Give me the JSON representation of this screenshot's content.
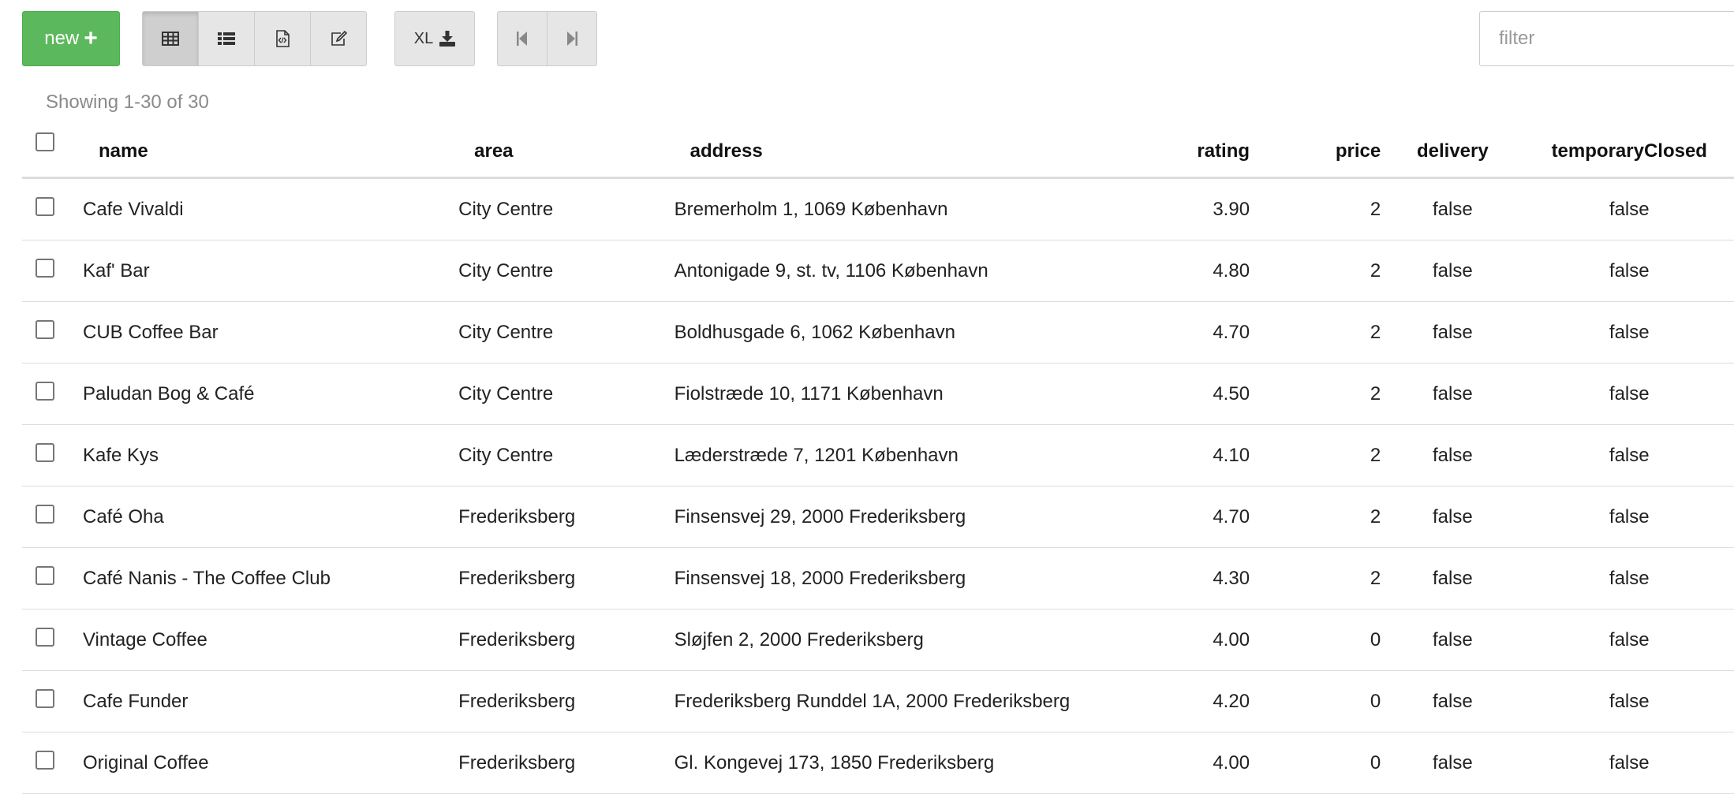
{
  "toolbar": {
    "new_label": "new",
    "new_icon": "plus-icon",
    "view_buttons": [
      "table-view-icon",
      "list-view-icon",
      "code-file-icon",
      "edit-icon"
    ],
    "excel_label": "XL",
    "excel_icon": "download-icon",
    "nav_buttons": [
      "first-page-icon",
      "last-page-icon"
    ],
    "filter_placeholder": "filter"
  },
  "status": {
    "showing": "Showing 1-30 of 30"
  },
  "table": {
    "columns": {
      "name": "name",
      "area": "area",
      "address": "address",
      "rating": "rating",
      "price": "price",
      "delivery": "delivery",
      "temporaryClosed": "temporaryClosed"
    },
    "rows": [
      {
        "name": "Cafe Vivaldi",
        "area": "City Centre",
        "address": "Bremerholm 1, 1069 København",
        "rating": "3.90",
        "price": "2",
        "delivery": "false",
        "temporaryClosed": "false"
      },
      {
        "name": "Kaf' Bar",
        "area": "City Centre",
        "address": "Antonigade 9, st. tv, 1106 København",
        "rating": "4.80",
        "price": "2",
        "delivery": "false",
        "temporaryClosed": "false"
      },
      {
        "name": "CUB Coffee Bar",
        "area": "City Centre",
        "address": "Boldhusgade 6, 1062 København",
        "rating": "4.70",
        "price": "2",
        "delivery": "false",
        "temporaryClosed": "false"
      },
      {
        "name": "Paludan Bog & Café",
        "area": "City Centre",
        "address": "Fiolstræde 10, 1171 København",
        "rating": "4.50",
        "price": "2",
        "delivery": "false",
        "temporaryClosed": "false"
      },
      {
        "name": "Kafe Kys",
        "area": "City Centre",
        "address": "Læderstræde 7, 1201 København",
        "rating": "4.10",
        "price": "2",
        "delivery": "false",
        "temporaryClosed": "false"
      },
      {
        "name": "Café Oha",
        "area": "Frederiksberg",
        "address": "Finsensvej 29, 2000 Frederiksberg",
        "rating": "4.70",
        "price": "2",
        "delivery": "false",
        "temporaryClosed": "false"
      },
      {
        "name": "Café Nanis - The Coffee Club",
        "area": "Frederiksberg",
        "address": "Finsensvej 18, 2000 Frederiksberg",
        "rating": "4.30",
        "price": "2",
        "delivery": "false",
        "temporaryClosed": "false"
      },
      {
        "name": "Vintage Coffee",
        "area": "Frederiksberg",
        "address": "Sløjfen 2, 2000 Frederiksberg",
        "rating": "4.00",
        "price": "0",
        "delivery": "false",
        "temporaryClosed": "false"
      },
      {
        "name": "Cafe Funder",
        "area": "Frederiksberg",
        "address": "Frederiksberg Runddel 1A, 2000 Frederiksberg",
        "rating": "4.20",
        "price": "0",
        "delivery": "false",
        "temporaryClosed": "false"
      },
      {
        "name": "Original Coffee",
        "area": "Frederiksberg",
        "address": "Gl. Kongevej 173, 1850 Frederiksberg",
        "rating": "4.00",
        "price": "0",
        "delivery": "false",
        "temporaryClosed": "false"
      }
    ]
  }
}
